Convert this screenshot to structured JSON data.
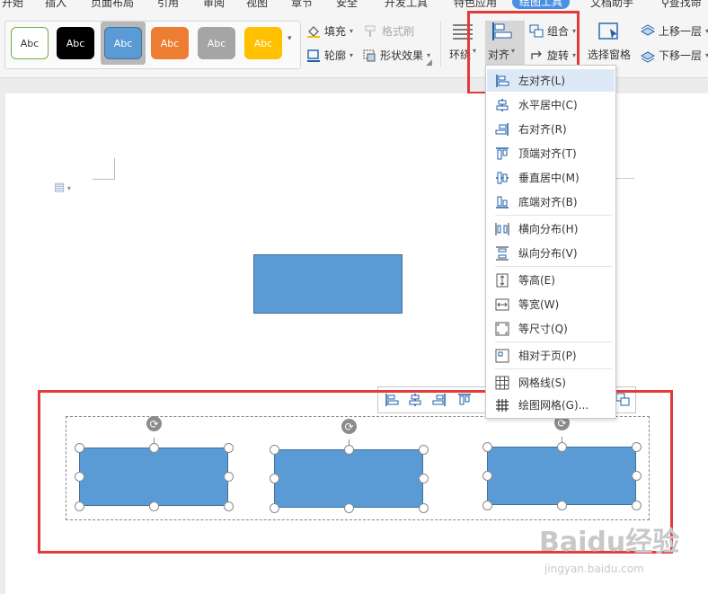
{
  "tabs": [
    "开始",
    "插入",
    "页面布局",
    "引用",
    "审阅",
    "视图",
    "章节",
    "安全",
    "开发工具",
    "特色应用",
    "绘图工具",
    "文档助手",
    "查找命"
  ],
  "active_tab": "绘图工具",
  "ribbon": {
    "shape_styles": [
      {
        "label": "Abc",
        "bg": "#ffffff",
        "fg": "#333333",
        "border": "#70ad47"
      },
      {
        "label": "Abc",
        "bg": "#000000",
        "fg": "#ffffff",
        "border": "#000000"
      },
      {
        "label": "Abc",
        "bg": "#5b9bd5",
        "fg": "#ffffff",
        "border": "#41719c"
      },
      {
        "label": "Abc",
        "bg": "#ed7d31",
        "fg": "#ffffff",
        "border": "#c55a11"
      },
      {
        "label": "Abc",
        "bg": "#a5a5a5",
        "fg": "#ffffff",
        "border": "#7f7f7f"
      },
      {
        "label": "Abc",
        "bg": "#ffc000",
        "fg": "#ffffff",
        "border": "#bf9000"
      }
    ],
    "fill": "填充",
    "format_painter": "格式刷",
    "outline": "轮廓",
    "shape_effect": "形状效果",
    "wrap": "环绕",
    "align": "对齐",
    "group": "组合",
    "rotate": "旋转",
    "selection_pane": "选择窗格",
    "bring_forward": "上移一层",
    "send_backward": "下移一层"
  },
  "align_menu": {
    "items": [
      {
        "label": "左对齐(L)",
        "icon": "align-left-icon"
      },
      {
        "label": "水平居中(C)",
        "icon": "align-center-icon"
      },
      {
        "label": "右对齐(R)",
        "icon": "align-right-icon"
      },
      {
        "label": "顶端对齐(T)",
        "icon": "align-top-icon"
      },
      {
        "label": "垂直居中(M)",
        "icon": "align-middle-icon"
      },
      {
        "label": "底端对齐(B)",
        "icon": "align-bottom-icon"
      },
      {
        "label": "横向分布(H)",
        "icon": "distribute-horizontal-icon"
      },
      {
        "label": "纵向分布(V)",
        "icon": "distribute-vertical-icon"
      },
      {
        "label": "等高(E)",
        "icon": "equal-height-icon"
      },
      {
        "label": "等宽(W)",
        "icon": "equal-width-icon"
      },
      {
        "label": "等尺寸(Q)",
        "icon": "equal-size-icon"
      },
      {
        "label": "相对于页(P)",
        "icon": "relative-to-page-icon"
      },
      {
        "label": "网格线(S)",
        "icon": "gridlines-icon"
      },
      {
        "label": "绘图网格(G)...",
        "icon": "drawing-grid-icon"
      }
    ],
    "highlighted": "左对齐(L)"
  },
  "colors": {
    "accent": "#4a90e2",
    "shape_fill": "#5b9bd5",
    "highlight_border": "#e33b3b"
  },
  "watermark": {
    "main": "Baidu经验",
    "sub": "jingyan.baidu.com"
  }
}
